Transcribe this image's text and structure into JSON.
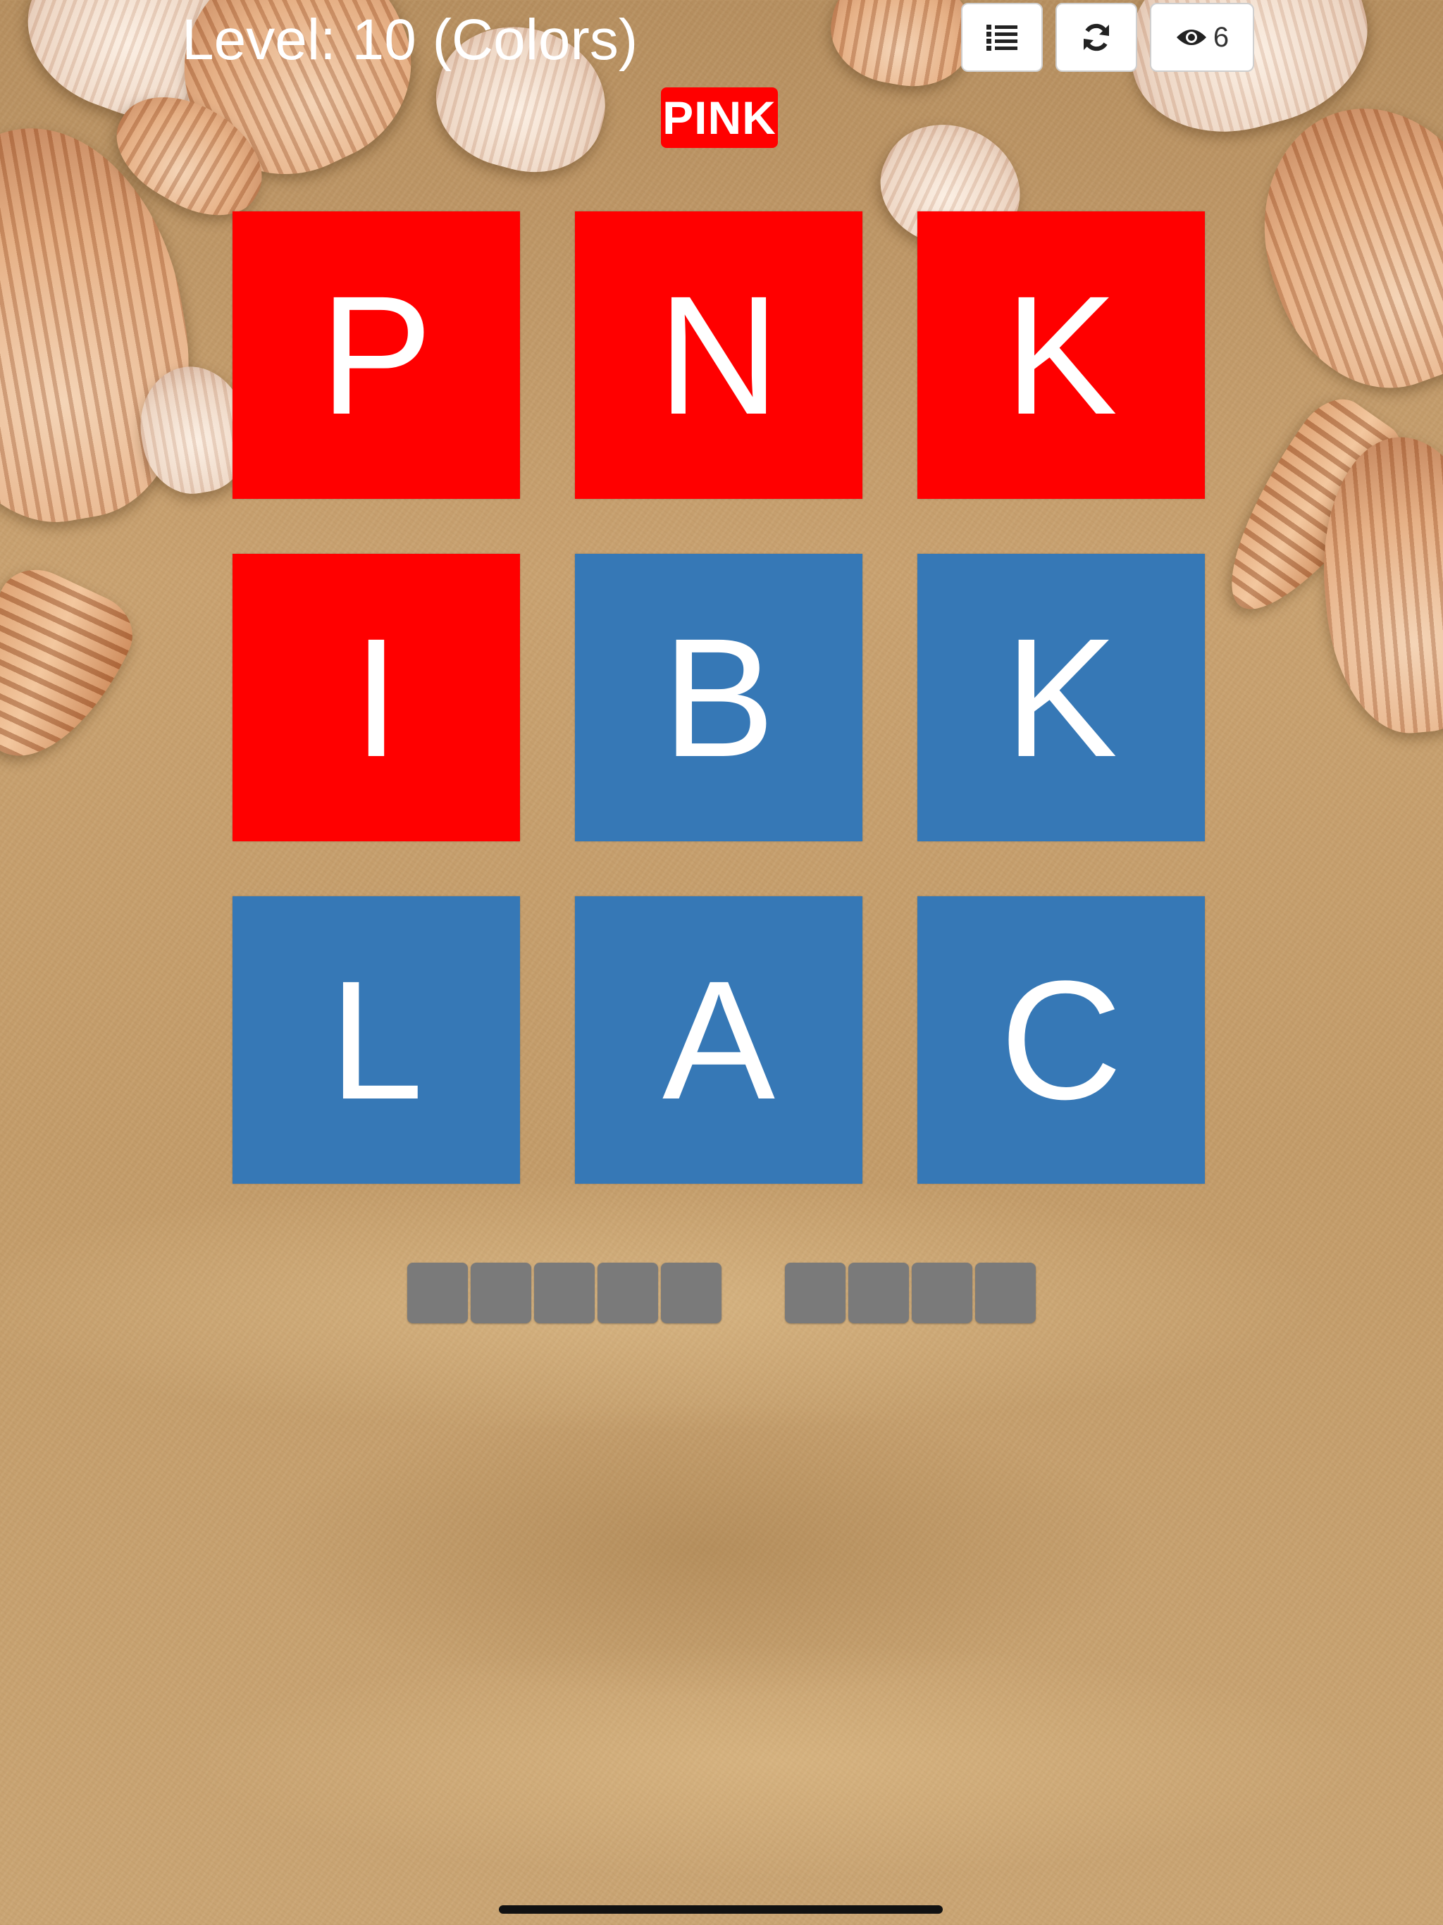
{
  "header": {
    "level_title": "Level: 10 (Colors)"
  },
  "toolbar": {
    "list_icon": "list-icon",
    "refresh_icon": "refresh-icon",
    "reveal_icon": "eye-icon",
    "reveal_count": "6"
  },
  "hint": {
    "label": "PINK",
    "color": "#ff0000"
  },
  "colors": {
    "tile_red": "#ff0000",
    "tile_blue": "#3678b6",
    "slot_gray": "#7a7a7a"
  },
  "board": {
    "tiles": [
      {
        "letter": "P",
        "color": "#ff0000"
      },
      {
        "letter": "N",
        "color": "#ff0000"
      },
      {
        "letter": "K",
        "color": "#ff0000"
      },
      {
        "letter": "I",
        "color": "#ff0000"
      },
      {
        "letter": "B",
        "color": "#3678b6"
      },
      {
        "letter": "K",
        "color": "#3678b6"
      },
      {
        "letter": "L",
        "color": "#3678b6"
      },
      {
        "letter": "A",
        "color": "#3678b6"
      },
      {
        "letter": "C",
        "color": "#3678b6"
      }
    ]
  },
  "answer": {
    "words": [
      5,
      4
    ]
  }
}
